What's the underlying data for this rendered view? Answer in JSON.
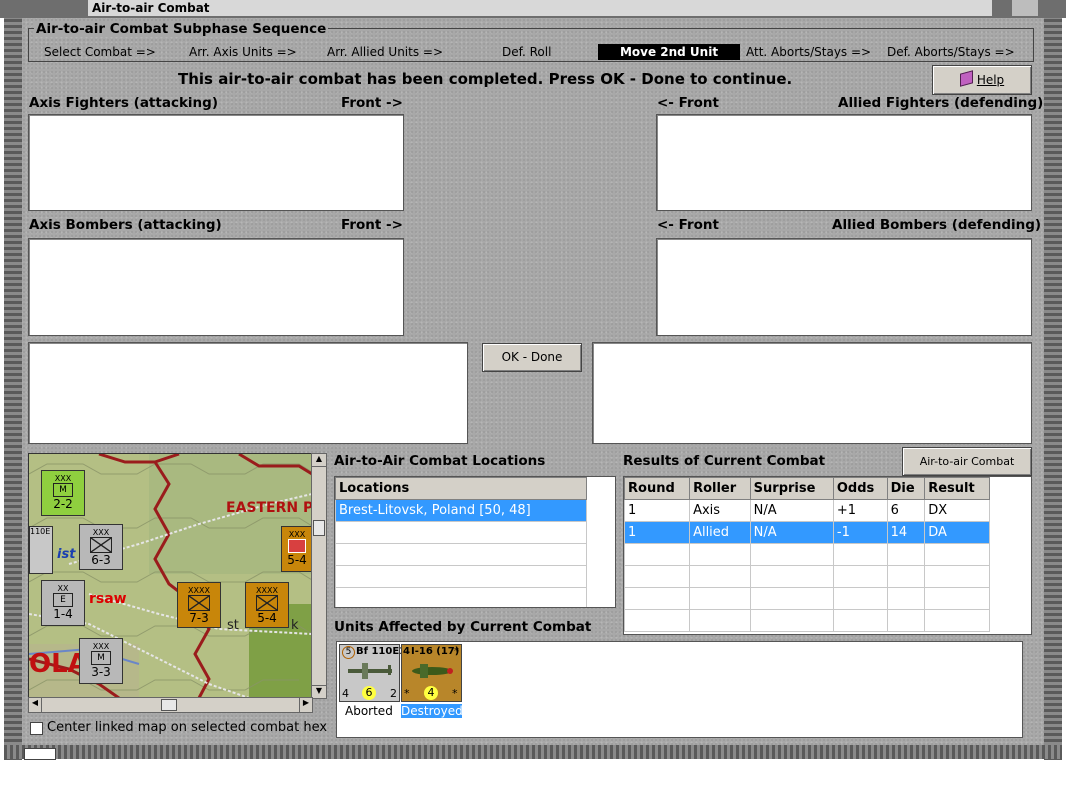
{
  "window": {
    "title": "Air-to-air Combat"
  },
  "sequence": {
    "legend": "Air-to-air Combat Subphase Sequence",
    "steps": [
      "Select Combat =>",
      "Arr. Axis Units =>",
      "Arr. Allied Units =>",
      "Def. Roll",
      "Move 2nd Unit",
      "Att. Aborts/Stays =>",
      "Def. Aborts/Stays =>"
    ],
    "active_step": "Move 2nd Unit"
  },
  "status_message": "This air-to-air combat has been completed.  Press OK - Done to continue.",
  "help_button": "Help",
  "panels": {
    "axis_fighters": "Axis Fighters (attacking)",
    "allied_fighters": "Allied Fighters (defending)",
    "axis_bombers": "Axis Bombers (attacking)",
    "allied_bombers": "Allied Bombers (defending)",
    "front_right": "Front ->",
    "front_left": "<- Front"
  },
  "ok_done_button": "OK - Done",
  "locations": {
    "title": "Air-to-Air Combat Locations",
    "header": "Locations",
    "rows": [
      "Brest-Litovsk, Poland [50, 48]"
    ]
  },
  "results": {
    "title": "Results of Current Combat",
    "chart_button": "Air-to-air Combat Chart",
    "columns": [
      "Round",
      "Roller",
      "Surprise",
      "Odds",
      "Die",
      "Result"
    ],
    "rows": [
      [
        "1",
        "Axis",
        "N/A",
        "+1",
        "6",
        "DX"
      ],
      [
        "1",
        "Allied",
        "N/A",
        "-1",
        "14",
        "DA"
      ]
    ],
    "selected_row": 1
  },
  "units_affected": {
    "title": "Units Affected by Current Combat",
    "units": [
      {
        "top_left": "5",
        "name": "Bf 110E1",
        "bottom_left": "4",
        "center": "6",
        "bottom_right": "2",
        "status": "Aborted",
        "color": "#c8c8c8"
      },
      {
        "top_left": "4",
        "name": "I-16 (17)",
        "top_right": "*",
        "bottom_left": "*",
        "center": "4",
        "bottom_right": "*",
        "status": "Destroyed",
        "color": "#b8862a"
      }
    ]
  },
  "map": {
    "labels": {
      "eastern": "EASTERN P",
      "warsaw": "rsaw",
      "pola": "OLA",
      "brest": "st",
      "k": "k",
      "ist": "ist"
    },
    "counters": [
      {
        "id": "c1",
        "top": "XXX",
        "bottom": "2-2",
        "size": "2",
        "color": "#8fcf3f"
      },
      {
        "id": "c2",
        "top": "XXX",
        "bottom": "6-3",
        "size": "4",
        "color": "#b8b8b8"
      },
      {
        "id": "c3",
        "top": "XX",
        "bottom": "1-4",
        "size": "3",
        "color": "#b8b8b8"
      },
      {
        "id": "c4",
        "top": "XXX",
        "bottom": "3-3",
        "size": "2",
        "color": "#b8b8b8"
      },
      {
        "id": "c5",
        "top": "XXXX",
        "bottom": "7-3",
        "color": "#c8860a"
      },
      {
        "id": "c6",
        "top": "XXXX",
        "bottom": "5-4",
        "color": "#c8860a"
      },
      {
        "id": "c7",
        "top": "XXX",
        "bottom": "5-4",
        "color": "#c8860a"
      }
    ],
    "left_edge_label": "110E"
  },
  "center_map_checkbox": {
    "label": "Center linked map on selected combat hex",
    "checked": false
  },
  "colors": {
    "selection": "#3399ff",
    "active_step_bg": "#000000",
    "counter_axis": "#b8b8b8",
    "counter_soviet": "#c8860a"
  }
}
